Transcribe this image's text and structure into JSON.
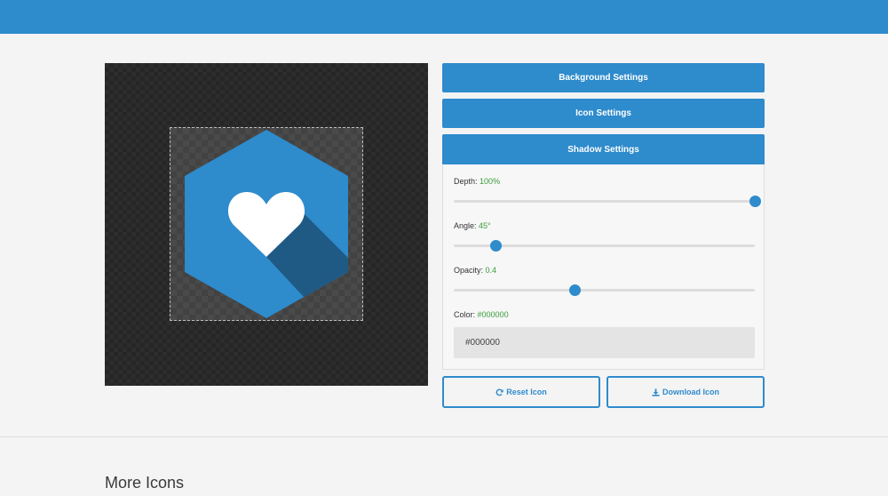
{
  "colors": {
    "accent": "#2e8bcc",
    "hexagon": "#2e8bcc",
    "shadow": "#1f5a85",
    "value_green": "#3a9b3a"
  },
  "preview": {
    "icon": "heart-icon",
    "shape": "hexagon"
  },
  "accordion": {
    "background": "Background Settings",
    "icon": "Icon Settings",
    "shadow": "Shadow Settings"
  },
  "shadow": {
    "depth": {
      "label": "Depth:",
      "value": "100%",
      "fraction": 1.0
    },
    "angle": {
      "label": "Angle:",
      "value": "45°",
      "fraction": 0.14
    },
    "opacity": {
      "label": "Opacity:",
      "value": "0.4",
      "fraction": 0.4
    },
    "color": {
      "label": "Color:",
      "value": "#000000",
      "input_value": "#000000"
    }
  },
  "actions": {
    "reset": {
      "label": "Reset Icon",
      "icon": "refresh-icon"
    },
    "download": {
      "label": "Download Icon",
      "icon": "download-icon"
    }
  },
  "more": {
    "title": "More Icons"
  }
}
